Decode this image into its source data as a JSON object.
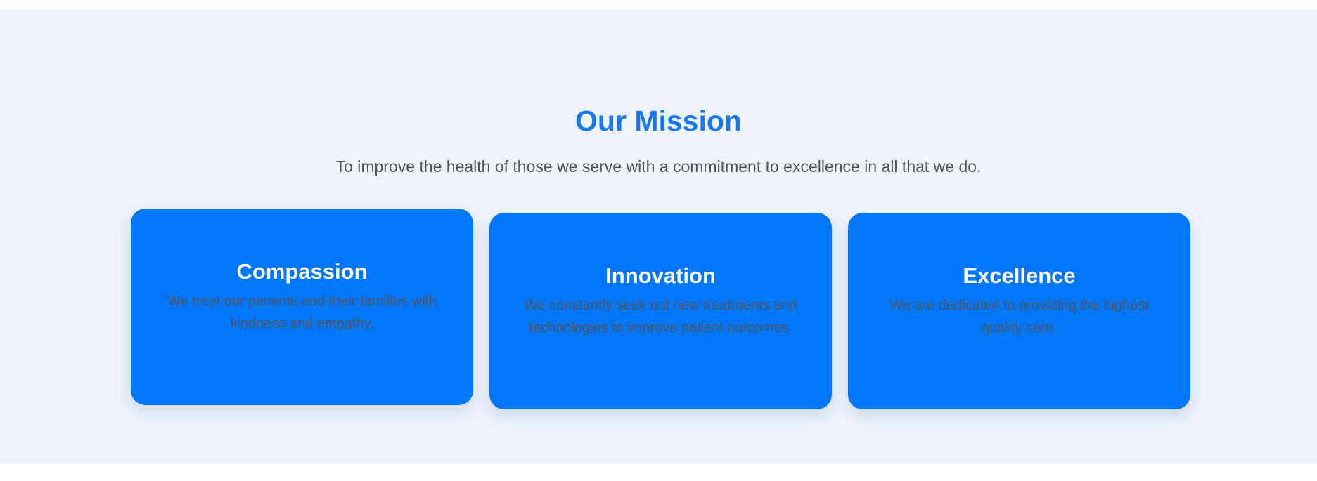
{
  "mission": {
    "title": "Our Mission",
    "subtitle": "To improve the health of those we serve with a commitment to excellence in all that we do.",
    "cards": [
      {
        "title": "Compassion",
        "text": "We treat our patients and their families with kindness and empathy."
      },
      {
        "title": "Innovation",
        "text": "We constantly seek out new treatments and technologies to improve patient outcomes."
      },
      {
        "title": "Excellence",
        "text": "We are dedicated to providing the highest quality care."
      }
    ]
  },
  "colors": {
    "section_background": "#eef3fc",
    "accent": "#1877f2",
    "card_background": "#0077fe",
    "body_text": "#555555",
    "card_title": "#ffffff"
  }
}
